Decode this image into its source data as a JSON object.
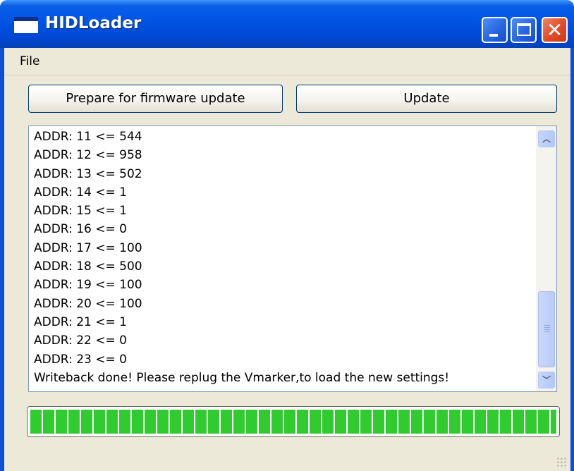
{
  "window": {
    "title": "HIDLoader",
    "icon": "app-window-icon",
    "controls": [
      "minimize-icon",
      "maximize-icon",
      "close-icon"
    ]
  },
  "menu": {
    "items": [
      {
        "label": "File"
      }
    ]
  },
  "buttons": {
    "prepare": "Prepare for firmware update",
    "update": "Update"
  },
  "log": {
    "lines": [
      "ADDR: 11 <= 544",
      "ADDR: 12 <= 958",
      "ADDR: 13 <= 502",
      "ADDR: 14 <= 1",
      "ADDR: 15 <= 1",
      "ADDR: 16 <= 0",
      "ADDR: 17 <= 100",
      "ADDR: 18 <= 500",
      "ADDR: 19 <= 100",
      "ADDR: 20 <= 100",
      "ADDR: 21 <= 1",
      "ADDR: 22 <= 0",
      "ADDR: 23 <= 0",
      "Writeback done! Please replug the Vmarker,to load the new settings!"
    ]
  },
  "progress": {
    "fraction": 1.0,
    "color": "#2fcb2f"
  },
  "colors": {
    "titlebar": "#0055e5",
    "client": "#ece9d8"
  }
}
